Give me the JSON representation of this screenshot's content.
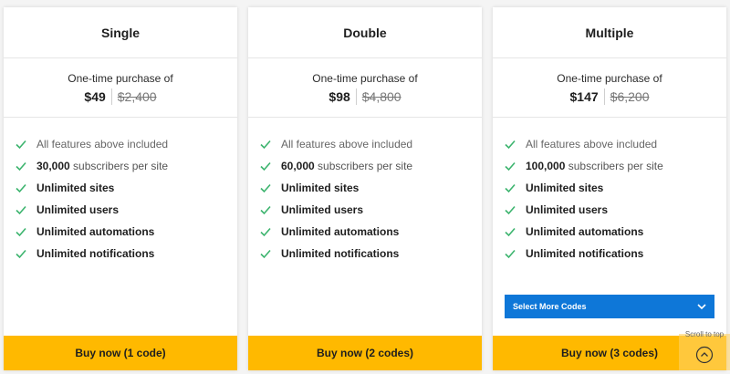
{
  "plans": [
    {
      "name": "Single",
      "price_caption": "One-time purchase of",
      "price_now": "$49",
      "price_old": "$2,400",
      "features": [
        {
          "num": "",
          "text": "All features above included"
        },
        {
          "num": "30,000",
          "text": " subscribers per site"
        },
        {
          "num": "",
          "text": "Unlimited sites"
        },
        {
          "num": "",
          "text": "Unlimited users"
        },
        {
          "num": "",
          "text": "Unlimited automations"
        },
        {
          "num": "",
          "text": "Unlimited notifications"
        }
      ],
      "buy_label": "Buy now (1 code)"
    },
    {
      "name": "Double",
      "price_caption": "One-time purchase of",
      "price_now": "$98",
      "price_old": "$4,800",
      "features": [
        {
          "num": "",
          "text": "All features above included"
        },
        {
          "num": "60,000",
          "text": " subscribers per site"
        },
        {
          "num": "",
          "text": "Unlimited sites"
        },
        {
          "num": "",
          "text": "Unlimited users"
        },
        {
          "num": "",
          "text": "Unlimited automations"
        },
        {
          "num": "",
          "text": "Unlimited notifications"
        }
      ],
      "buy_label": "Buy now (2 codes)"
    },
    {
      "name": "Multiple",
      "price_caption": "One-time purchase of",
      "price_now": "$147",
      "price_old": "$6,200",
      "features": [
        {
          "num": "",
          "text": "All features above included"
        },
        {
          "num": "100,000",
          "text": " subscribers per site"
        },
        {
          "num": "",
          "text": "Unlimited sites"
        },
        {
          "num": "",
          "text": "Unlimited users"
        },
        {
          "num": "",
          "text": "Unlimited automations"
        },
        {
          "num": "",
          "text": "Unlimited notifications"
        }
      ],
      "select_label": "Select More Codes",
      "buy_label": "Buy now (3 codes)"
    }
  ],
  "scroll_to_top": {
    "label": "Scroll to top",
    "icon": "chevron-up-circle-icon"
  },
  "icons": {
    "feature_check": "check-icon",
    "select_chevron": "chevron-down-icon"
  },
  "colors": {
    "accent_button": "#ffb900",
    "select_button": "#0e77d8",
    "check": "#3cb46e"
  }
}
